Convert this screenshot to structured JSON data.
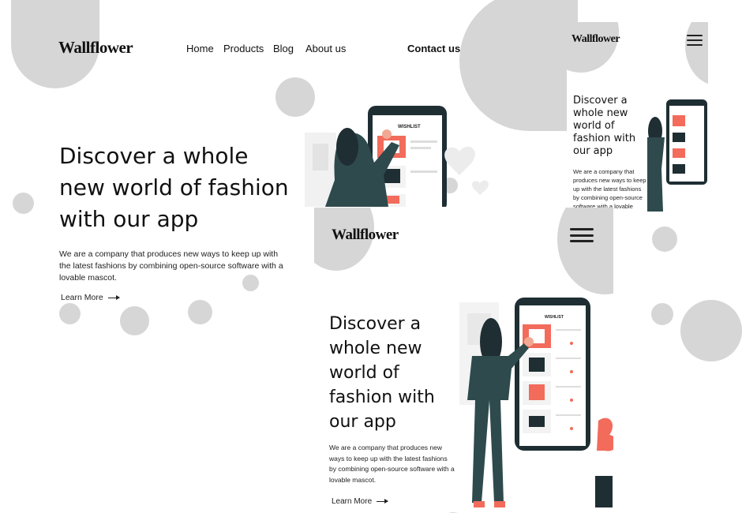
{
  "brand": {
    "logo": "Wallflower"
  },
  "nav": {
    "home": "Home",
    "products": "Products",
    "blog": "Blog",
    "about": "About us",
    "contact": "Contact us"
  },
  "hero": {
    "headline_desktop": "Discover a whole new world of fashion with our app",
    "headline_mobile": "Discover a whole new world of fashion with our app",
    "description": "We are a company that produces new ways to keep up with the latest fashions by combining open-source software with a lovable mascot.",
    "learn_more": "Learn More"
  },
  "illustration": {
    "app_title": "WISHLIST"
  },
  "icons": [
    "arrow-right-icon",
    "hamburger-menu-icon",
    "heart-icon",
    "home-icon"
  ],
  "colors": {
    "accent": "#f26b5b",
    "dark": "#1f3a3d",
    "circle": "#d6d6d6",
    "phone": "#1e2e33"
  }
}
